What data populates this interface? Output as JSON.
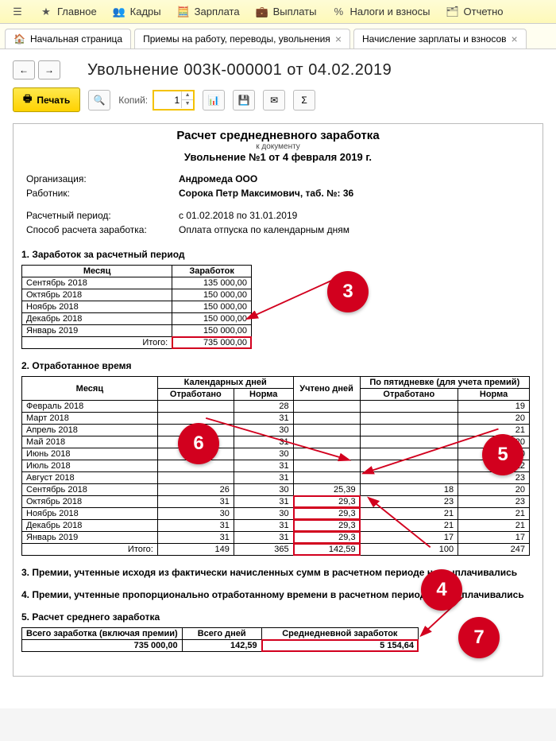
{
  "menu": [
    "Главное",
    "Кадры",
    "Зарплата",
    "Выплаты",
    "Налоги и взносы",
    "Отчетно"
  ],
  "tabs": [
    {
      "label": "Начальная страница",
      "close": false,
      "home": true
    },
    {
      "label": "Приемы на работу, переводы, увольнения",
      "close": true
    },
    {
      "label": "Начисление зарплаты и взносов",
      "close": true
    }
  ],
  "nav_back": "←",
  "nav_fwd": "→",
  "doc_title": "Увольнение 003К-000001 от 04.02.2019",
  "toolbar": {
    "print": "Печать",
    "copies_label": "Копий:",
    "copies_value": "1"
  },
  "report": {
    "title": "Расчет среднедневного заработка",
    "sub": "к документу",
    "doc": "Увольнение №1 от 4 февраля 2019 г.",
    "org_label": "Организация:",
    "org_value": "Андромеда ООО",
    "emp_label": "Работник:",
    "emp_value": "Сорока Петр Максимович, таб. №: 36",
    "period_label": "Расчетный период:",
    "period_value": "с 01.02.2018 по 31.01.2019",
    "method_label": "Способ расчета заработка:",
    "method_value": "Оплата отпуска по календарным дням"
  },
  "section1": {
    "title": "1. Заработок за расчетный период",
    "head_month": "Месяц",
    "head_earn": "Заработок",
    "rows": [
      {
        "m": "Сентябрь 2018",
        "v": "135 000,00"
      },
      {
        "m": "Октябрь 2018",
        "v": "150 000,00"
      },
      {
        "m": "Ноябрь 2018",
        "v": "150 000,00"
      },
      {
        "m": "Декабрь 2018",
        "v": "150 000,00"
      },
      {
        "m": "Январь 2019",
        "v": "150 000,00"
      }
    ],
    "total_label": "Итого:",
    "total_value": "735 000,00"
  },
  "section2": {
    "title": "2. Отработанное время",
    "head_month": "Месяц",
    "head_cal": "Календарных дней",
    "head_acc": "Учтено дней",
    "head_five": "По пятидневке (для учета премий)",
    "sub_worked": "Отработано",
    "sub_norm": "Норма",
    "rows": [
      {
        "m": "Февраль 2018",
        "cw": "",
        "cn": "28",
        "ad": "",
        "fw": "",
        "fn": "19"
      },
      {
        "m": "Март 2018",
        "cw": "",
        "cn": "31",
        "ad": "",
        "fw": "",
        "fn": "20"
      },
      {
        "m": "Апрель 2018",
        "cw": "",
        "cn": "30",
        "ad": "",
        "fw": "",
        "fn": "21"
      },
      {
        "m": "Май 2018",
        "cw": "",
        "cn": "31",
        "ad": "",
        "fw": "",
        "fn": "20"
      },
      {
        "m": "Июнь 2018",
        "cw": "",
        "cn": "30",
        "ad": "",
        "fw": "",
        "fn": "20"
      },
      {
        "m": "Июль 2018",
        "cw": "",
        "cn": "31",
        "ad": "",
        "fw": "",
        "fn": "22"
      },
      {
        "m": "Август 2018",
        "cw": "",
        "cn": "31",
        "ad": "",
        "fw": "",
        "fn": "23"
      },
      {
        "m": "Сентябрь 2018",
        "cw": "26",
        "cn": "30",
        "ad": "25,39",
        "fw": "18",
        "fn": "20"
      },
      {
        "m": "Октябрь 2018",
        "cw": "31",
        "cn": "31",
        "ad": "29,3",
        "fw": "23",
        "fn": "23"
      },
      {
        "m": "Ноябрь 2018",
        "cw": "30",
        "cn": "30",
        "ad": "29,3",
        "fw": "21",
        "fn": "21"
      },
      {
        "m": "Декабрь 2018",
        "cw": "31",
        "cn": "31",
        "ad": "29,3",
        "fw": "21",
        "fn": "21"
      },
      {
        "m": "Январь 2019",
        "cw": "31",
        "cn": "31",
        "ad": "29,3",
        "fw": "17",
        "fn": "17"
      }
    ],
    "total_label": "Итого:",
    "totals": {
      "cw": "149",
      "cn": "365",
      "ad": "142,59",
      "fw": "100",
      "fn": "247"
    }
  },
  "section3": "3. Премии, учтенные исходя из фактически начисленных сумм в расчетном периоде не выплачивались",
  "section4": "4. Премии, учтенные пропорционально отработанному времени в расчетном периоде не выплачивались",
  "section5": {
    "title": "5. Расчет среднего  заработка",
    "h1": "Всего заработка (включая премии)",
    "h2": "Всего дней",
    "h3": "Среднедневной заработок",
    "v1": "735 000,00",
    "v2": "142,59",
    "v3": "5 154,64"
  },
  "callouts": {
    "c3": "3",
    "c4": "4",
    "c5": "5",
    "c6": "6",
    "c7": "7"
  }
}
